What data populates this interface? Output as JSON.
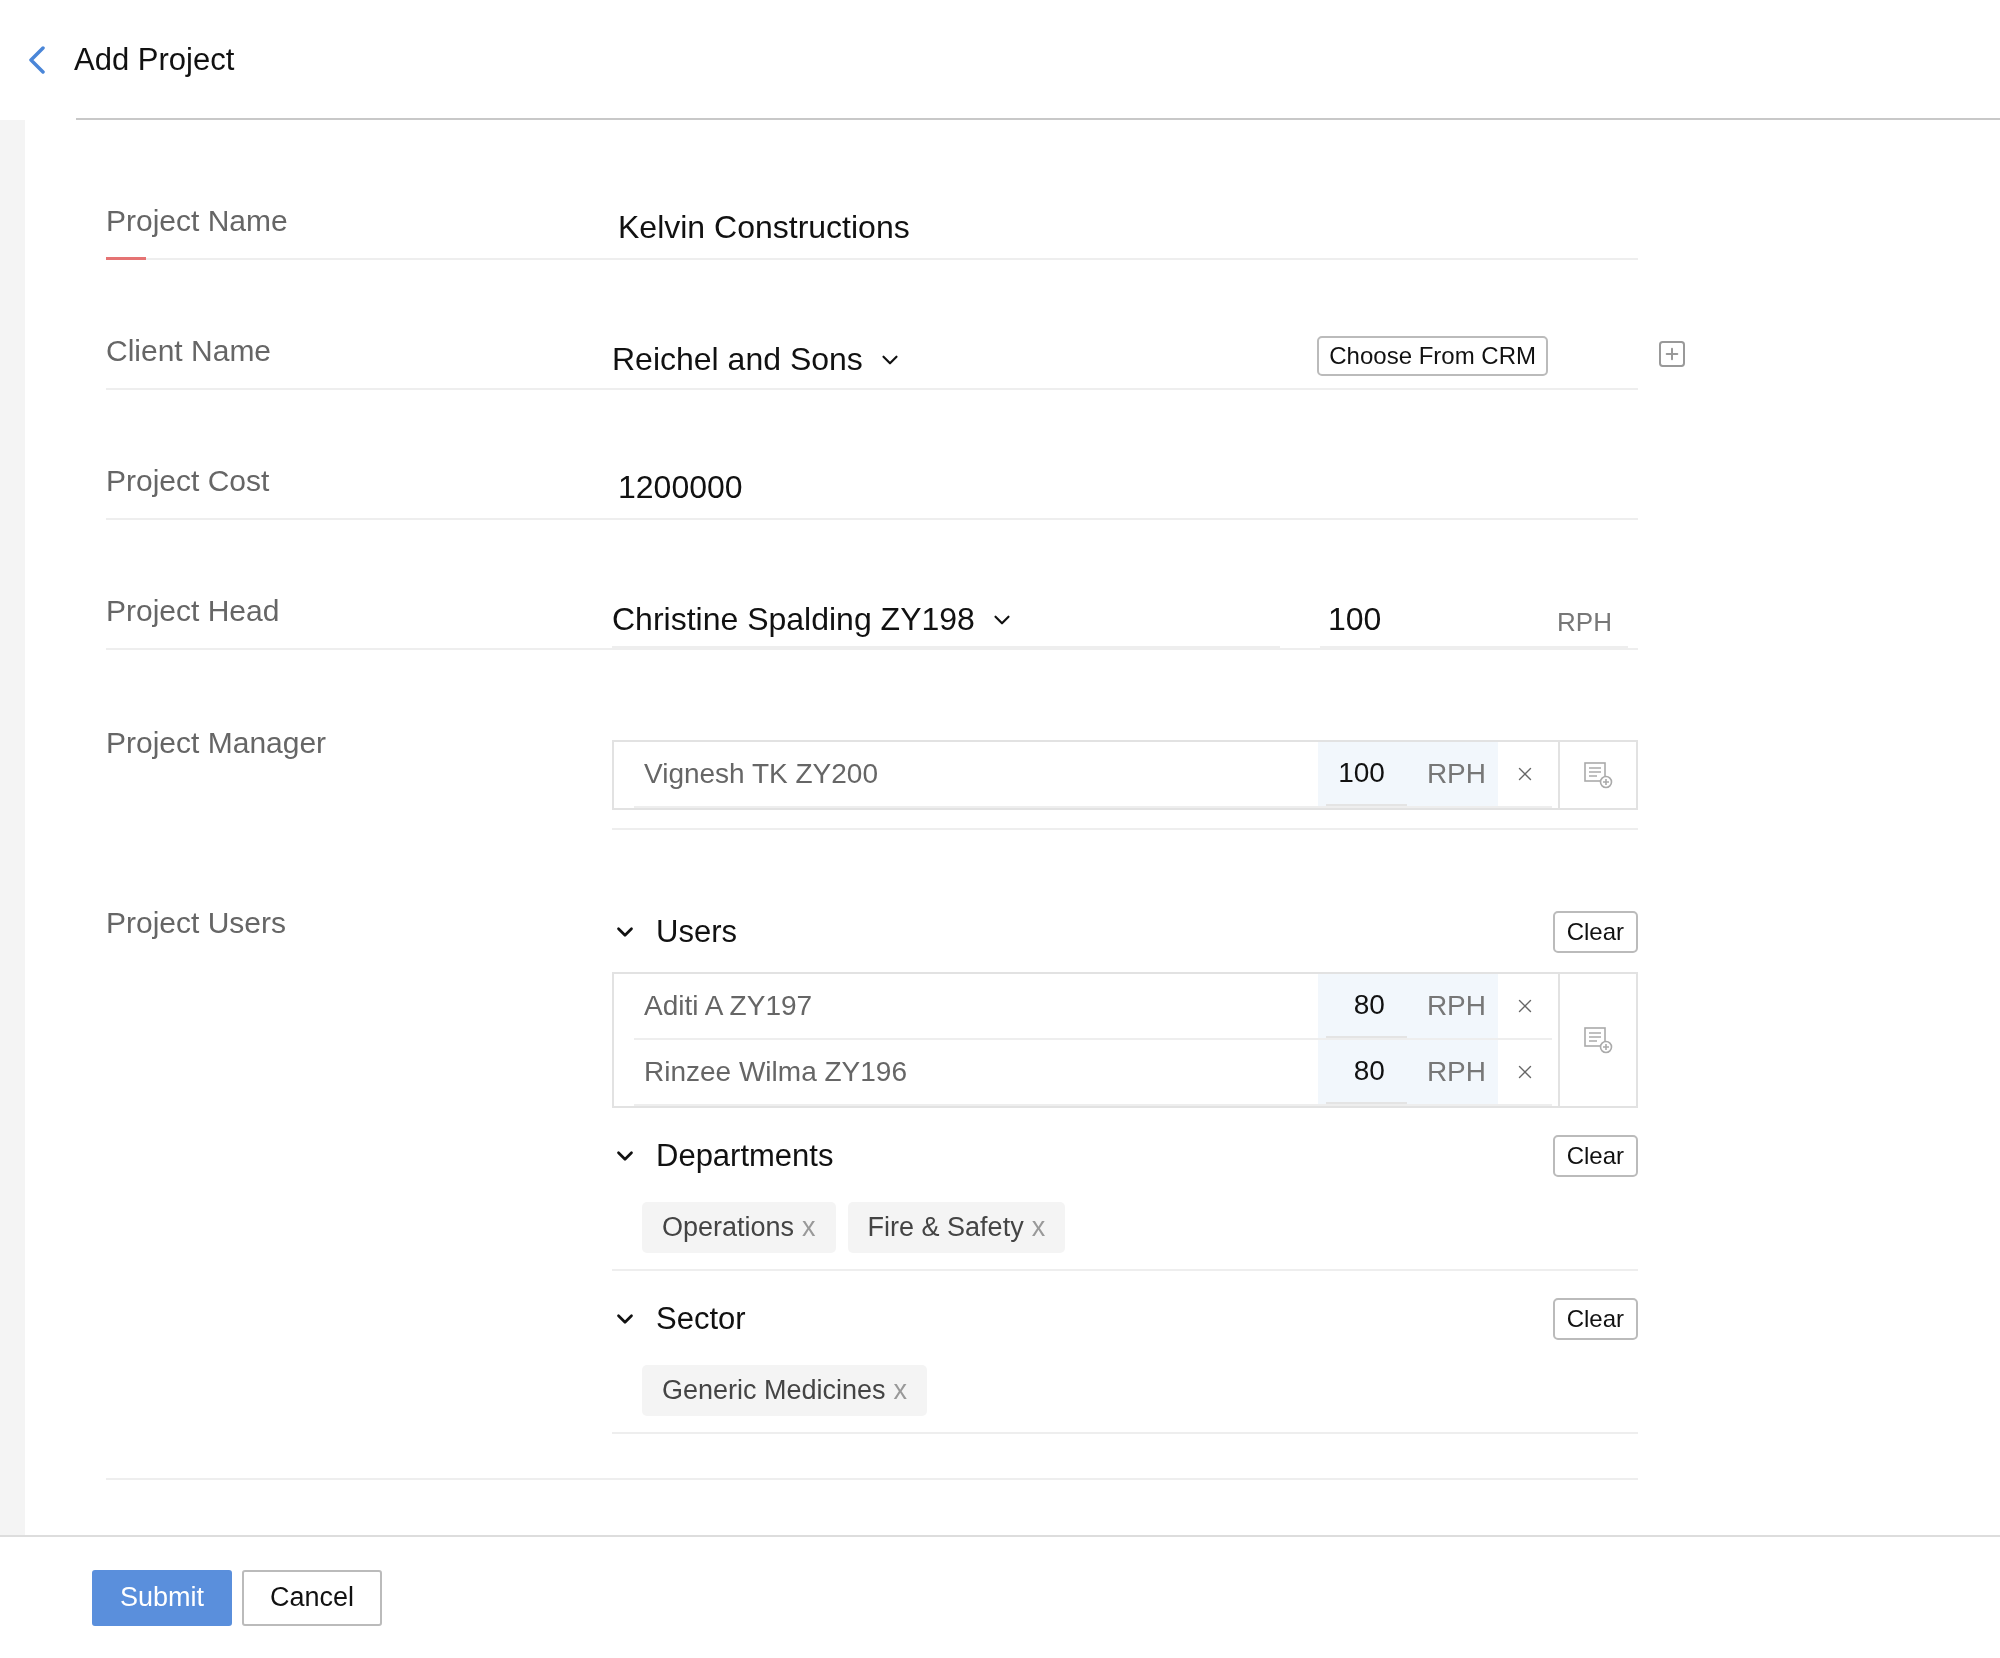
{
  "header": {
    "title": "Add Project"
  },
  "fields": [
    {
      "kind": "text",
      "label": "Project Name",
      "value": "Kelvin Constructions",
      "focused": true
    },
    {
      "kind": "select",
      "label": "Client Name",
      "value": "Reichel and Sons",
      "button": "Choose From CRM"
    },
    {
      "kind": "text",
      "label": "Project Cost",
      "value": "1200000",
      "focused": false
    },
    {
      "kind": "head",
      "label": "Project Head",
      "value": "Christine Spalding ZY198",
      "rate": "100",
      "unit": "RPH"
    },
    {
      "kind": "people",
      "label": "Project Manager",
      "people": [
        {
          "name": "Vignesh TK ZY200",
          "rate": "100",
          "unit": "RPH"
        }
      ]
    }
  ],
  "project_users": {
    "label": "Project Users",
    "groups": [
      {
        "kind": "people",
        "title": "Users",
        "expanded": true,
        "clear": "Clear",
        "people": [
          {
            "name": "Aditi A ZY197",
            "rate": "80",
            "unit": "RPH"
          },
          {
            "name": "Rinzee Wilma ZY196",
            "rate": "80",
            "unit": "RPH"
          }
        ]
      },
      {
        "kind": "tags",
        "title": "Departments",
        "expanded": true,
        "clear": "Clear",
        "tags": [
          {
            "label": "Operations",
            "remove": "x"
          },
          {
            "label": "Fire & Safety",
            "remove": "x"
          }
        ]
      },
      {
        "kind": "tags",
        "title": "Sector",
        "expanded": true,
        "clear": "Clear",
        "tags": [
          {
            "label": "Generic Medicines",
            "remove": "x"
          }
        ]
      }
    ]
  },
  "footer": {
    "buttons": [
      {
        "label": "Submit",
        "primary": true
      },
      {
        "label": "Cancel",
        "primary": false
      }
    ]
  }
}
